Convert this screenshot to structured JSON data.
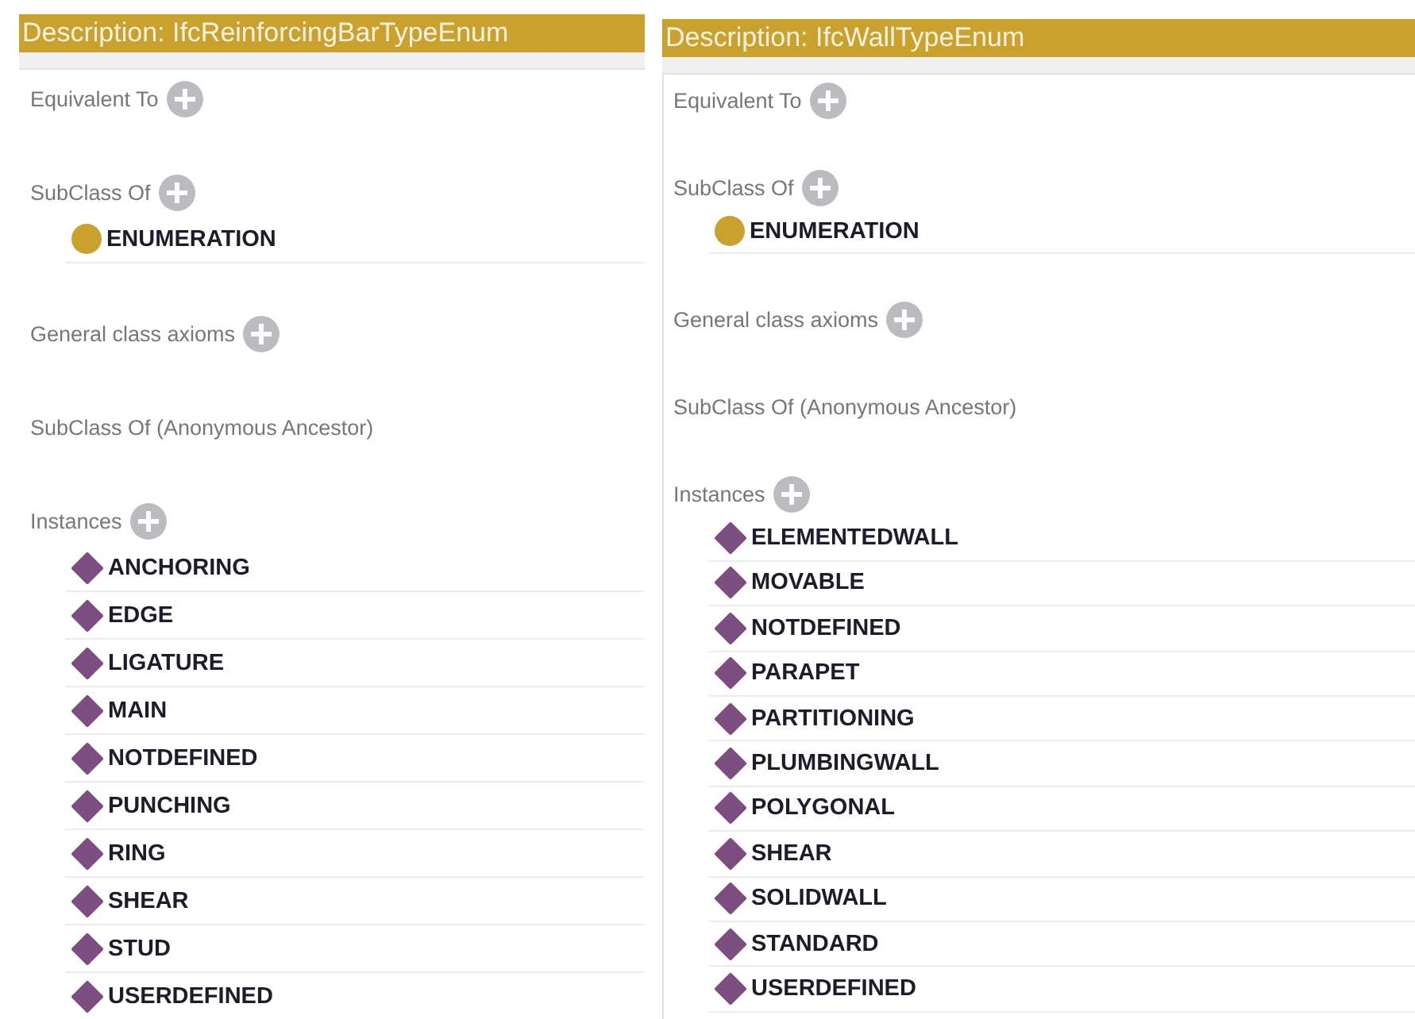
{
  "panels": [
    {
      "title": "Description: IfcReinforcingBarTypeEnum",
      "sections": [
        {
          "label": "Equivalent To",
          "add": true
        },
        {
          "label": "SubClass Of",
          "add": true,
          "items": [
            {
              "kind": "class",
              "label": "ENUMERATION"
            }
          ]
        },
        {
          "label": "General class axioms",
          "add": true
        },
        {
          "label": "SubClass Of (Anonymous Ancestor)",
          "add": false
        },
        {
          "label": "Instances",
          "add": true,
          "items": [
            {
              "kind": "individual",
              "label": "ANCHORING"
            },
            {
              "kind": "individual",
              "label": "EDGE"
            },
            {
              "kind": "individual",
              "label": "LIGATURE"
            },
            {
              "kind": "individual",
              "label": "MAIN"
            },
            {
              "kind": "individual",
              "label": "NOTDEFINED"
            },
            {
              "kind": "individual",
              "label": "PUNCHING"
            },
            {
              "kind": "individual",
              "label": "RING"
            },
            {
              "kind": "individual",
              "label": "SHEAR"
            },
            {
              "kind": "individual",
              "label": "STUD"
            },
            {
              "kind": "individual",
              "label": "USERDEFINED"
            }
          ]
        }
      ]
    },
    {
      "title": "Description: IfcWallTypeEnum",
      "sections": [
        {
          "label": "Equivalent To",
          "add": true
        },
        {
          "label": "SubClass Of",
          "add": true,
          "items": [
            {
              "kind": "class",
              "label": "ENUMERATION"
            }
          ]
        },
        {
          "label": "General class axioms",
          "add": true
        },
        {
          "label": "SubClass Of (Anonymous Ancestor)",
          "add": false
        },
        {
          "label": "Instances",
          "add": true,
          "items": [
            {
              "kind": "individual",
              "label": "ELEMENTEDWALL"
            },
            {
              "kind": "individual",
              "label": "MOVABLE"
            },
            {
              "kind": "individual",
              "label": "NOTDEFINED"
            },
            {
              "kind": "individual",
              "label": "PARAPET"
            },
            {
              "kind": "individual",
              "label": "PARTITIONING"
            },
            {
              "kind": "individual",
              "label": "PLUMBINGWALL"
            },
            {
              "kind": "individual",
              "label": "POLYGONAL"
            },
            {
              "kind": "individual",
              "label": "SHEAR"
            },
            {
              "kind": "individual",
              "label": "SOLIDWALL"
            },
            {
              "kind": "individual",
              "label": "STANDARD"
            },
            {
              "kind": "individual",
              "label": "USERDEFINED"
            }
          ]
        }
      ]
    }
  ]
}
